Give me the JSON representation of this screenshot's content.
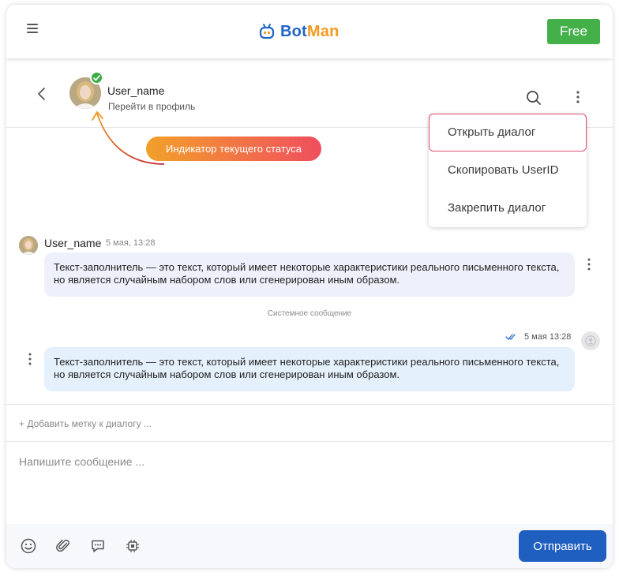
{
  "header": {
    "menu_icon": "hamburger-icon",
    "logo": {
      "bot": "Bot",
      "man": "Man",
      "bot_color": "#2264c4",
      "man_color": "#f29a22"
    },
    "plan_label": "Free",
    "plan_color": "#44b04a"
  },
  "chat_header": {
    "back_icon": "chevron-left-icon",
    "user_name": "User_name",
    "profile_link": "Перейти в профиль",
    "status_icon": "check-icon",
    "status_color": "#3cab44",
    "search_icon": "search-icon",
    "more_icon": "more-vertical-icon"
  },
  "menu": {
    "items": [
      {
        "label": "Открыть диалог",
        "active": true
      },
      {
        "label": "Скопировать UserID",
        "active": false
      },
      {
        "label": "Закрепить диалог",
        "active": false
      }
    ],
    "active_border_color": "#e0506a"
  },
  "annotation": {
    "label": "Индикатор текущего статуса",
    "gradient": [
      "#f2a02a",
      "#f04e5e"
    ]
  },
  "messages": [
    {
      "direction": "incoming",
      "author": "User_name",
      "time": "5 мая, 13:28",
      "text": "Текст-заполнитель — это текст, который имеет некоторые характеристики реального письменного текста, но является случайным набором слов или сгенерирован иным образом."
    },
    {
      "direction": "outgoing",
      "time": "5 мая 13:28",
      "read_icon": "double-check-icon",
      "text": "Текст-заполнитель — это текст, который имеет некоторые характеристики реального письменного текста, но является случайным набором слов или сгенерирован иным образом."
    }
  ],
  "system_message": "Системное сообщение",
  "tag_row": {
    "label": "+ Добавить метку к диалогу ..."
  },
  "composer": {
    "placeholder": "Напишите сообщение ...",
    "value": "",
    "tools": [
      "emoji-icon",
      "paperclip-icon",
      "quick-reply-icon",
      "bot-icon"
    ],
    "send_label": "Отправить",
    "send_color": "#1f5fc0"
  }
}
